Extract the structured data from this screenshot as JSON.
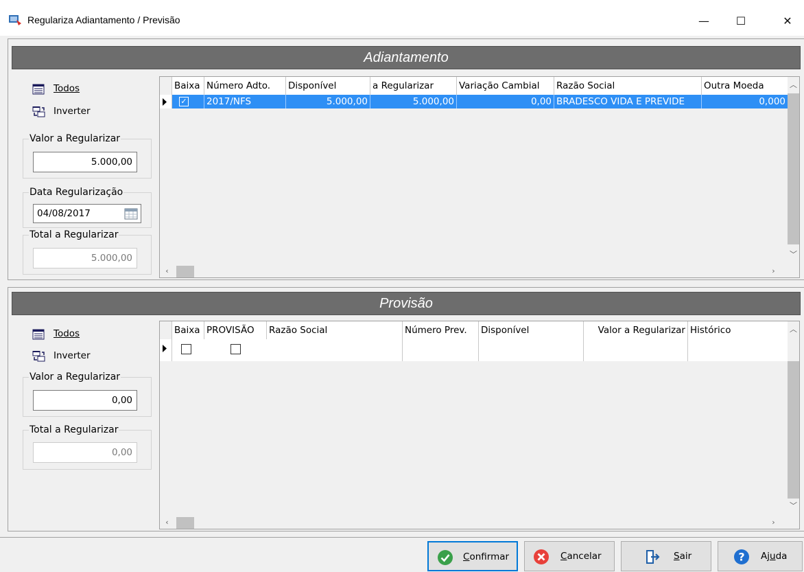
{
  "window": {
    "title": "Regulariza Adiantamento / Previsão",
    "minimize": "—",
    "maximize": "☐",
    "close": "✕"
  },
  "adiantamento": {
    "banner": "Adiantamento",
    "todos_label": "Todos",
    "inverter_label": "Inverter",
    "valor_legend": "Valor a Regularizar",
    "valor_value": "5.000,00",
    "data_legend": "Data Regularização",
    "data_value": "04/08/2017",
    "total_legend": "Total a Regularizar",
    "total_value": "5.000,00",
    "grid": {
      "columns": [
        "Baixa",
        "Número Adto.",
        "Disponível",
        "a Regularizar",
        "Variação Cambial",
        "Razão Social",
        "Outra Moeda"
      ],
      "rows": [
        {
          "baixa": "☑",
          "numero": "2017/NFS",
          "disponivel": "5.000,00",
          "a_regularizar": "5.000,00",
          "variacao": "0,00",
          "razao": "BRADESCO VIDA E PREVIDE",
          "outra_moeda": "0,000"
        }
      ]
    }
  },
  "provisao": {
    "banner": "Provisão",
    "todos_label": "Todos",
    "inverter_label": "Inverter",
    "valor_legend": "Valor a Regularizar",
    "valor_value": "0,00",
    "total_legend": "Total a Regularizar",
    "total_value": "0,00",
    "grid": {
      "columns": [
        "Baixa",
        "PROVISÃO",
        "Razão Social",
        "Número Prev.",
        "Disponível",
        "Valor a Regularizar",
        "Histórico"
      ]
    }
  },
  "buttons": {
    "confirmar": {
      "prefix": "",
      "mnemonic": "C",
      "rest": "onfirmar"
    },
    "cancelar": {
      "prefix": "",
      "mnemonic": "C",
      "rest": "ancelar"
    },
    "sair": {
      "prefix": "",
      "mnemonic": "S",
      "rest": "air"
    },
    "ajuda": {
      "prefix": "Aj",
      "mnemonic": "u",
      "rest": "da"
    }
  },
  "colors": {
    "accent_selection": "#2e8ff5",
    "banner": "#6d6d6d",
    "confirm_icon": "#3aa04a",
    "cancel_icon": "#e8403a",
    "help_icon": "#1f6fd0"
  }
}
